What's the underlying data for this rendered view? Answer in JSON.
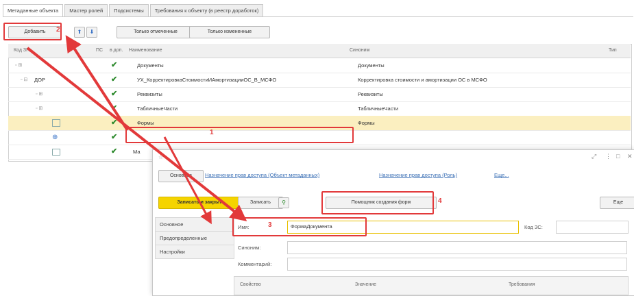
{
  "tabs": [
    "Метаданные объекта",
    "Мастер ролей",
    "Подсистемы",
    "Требования к объекту (в реестр доработок)"
  ],
  "toolbar": {
    "add_label": "Добавить",
    "only_checked": "Только отмеченные",
    "only_changed": "Только измененные"
  },
  "table": {
    "headers": {
      "code": "Код ЗП",
      "flag": "ПС",
      "enabled": "в доп.",
      "name": "Наименование",
      "synonym": "Синоним",
      "type": "Тип"
    },
    "rows": [
      {
        "tree": "▫ ⊞",
        "code": "",
        "name": "Документы",
        "synonym": "Документы"
      },
      {
        "tree": "▫ ⊟",
        "code": "ДОР",
        "name": "УХ_КорректировкаСтоимостиИАмортизацииОС_В_МСФО",
        "synonym": "Корректировка стоимости и амортизации ОС в МСФО"
      },
      {
        "tree": "▫ ⊞",
        "code": "",
        "name": "Реквизиты",
        "synonym": "Реквизиты"
      },
      {
        "tree": "▫ ⊞",
        "code": "",
        "name": "ТабличныеЧасти",
        "synonym": "ТабличныеЧасти"
      },
      {
        "tree": "",
        "code": "",
        "name": "Формы",
        "synonym": "Формы"
      },
      {
        "tree": "",
        "code": "",
        "name": "",
        "synonym": ""
      },
      {
        "tree": "",
        "code": "",
        "name": "Ма",
        "synonym": ""
      }
    ]
  },
  "modal": {
    "tabs": {
      "main": "Основное",
      "link1": "Назначение прав доступа (Объект метаданных)",
      "link2": "Назначение прав доступа (Роль)",
      "more": "Еще..."
    },
    "buttons": {
      "save_close": "Записать и закрыть",
      "save": "Записать",
      "wizard": "Помощник создания форм",
      "more": "Еще"
    },
    "side_items": [
      "Основное",
      "Предопределенные",
      "Настройки"
    ],
    "fields": {
      "name_label": "Имя:",
      "name_value": "ФормаДокумента",
      "code_label": "Код ЗС:",
      "synonym_label": "Синоним:",
      "comment_label": "Комментарий:"
    },
    "subtable_headers": [
      "Свойство",
      "Значение",
      "Требования"
    ]
  },
  "annotations": [
    "1",
    "2",
    "3",
    "4"
  ],
  "colors": {
    "accent_red": "#e2393a",
    "highlight_yellow": "#f5d400",
    "selected_row": "#fbefc0",
    "check_green": "#2d8a2d"
  }
}
